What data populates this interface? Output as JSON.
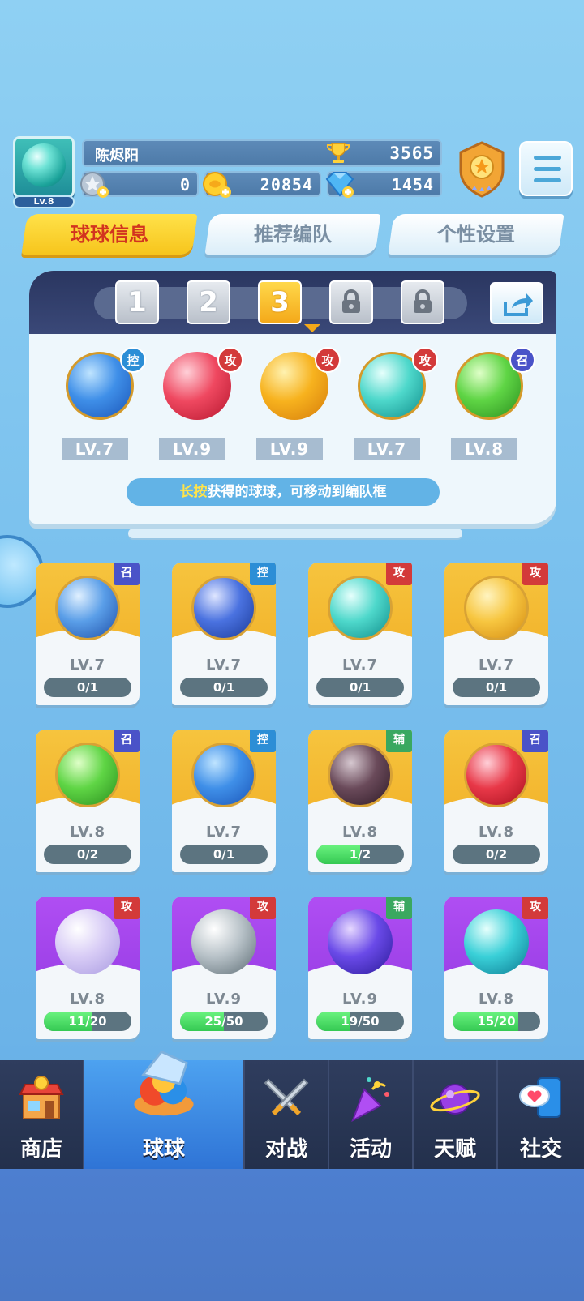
{
  "player": {
    "name": "陈烬阳",
    "level": "Lv.8",
    "trophies": "3565",
    "resource_1": "0",
    "gold": "20854",
    "gems": "1454"
  },
  "tabs": [
    "球球信息",
    "推荐编队",
    "个性设置"
  ],
  "team_slots": [
    "1",
    "2",
    "3",
    "lock",
    "lock"
  ],
  "active_slot": "3",
  "team": [
    {
      "level": "LV.7",
      "badge": "控"
    },
    {
      "level": "LV.9",
      "badge": "攻"
    },
    {
      "level": "LV.9",
      "badge": "攻"
    },
    {
      "level": "LV.7",
      "badge": "攻"
    },
    {
      "level": "LV.8",
      "badge": "召"
    }
  ],
  "hint": {
    "highlight": "长按",
    "rest": "获得的球球，可移动到编队框"
  },
  "cards": [
    {
      "level": "LV.7",
      "badge": "召",
      "progress": "0/1",
      "fraction": 0
    },
    {
      "level": "LV.7",
      "badge": "控",
      "progress": "0/1",
      "fraction": 0
    },
    {
      "level": "LV.7",
      "badge": "攻",
      "progress": "0/1",
      "fraction": 0
    },
    {
      "level": "LV.7",
      "badge": "攻",
      "progress": "0/1",
      "fraction": 0
    },
    {
      "level": "LV.8",
      "badge": "召",
      "progress": "0/2",
      "fraction": 0
    },
    {
      "level": "LV.7",
      "badge": "控",
      "progress": "0/1",
      "fraction": 0
    },
    {
      "level": "LV.8",
      "badge": "辅",
      "progress": "1/2",
      "fraction": 0.5
    },
    {
      "level": "LV.8",
      "badge": "召",
      "progress": "0/2",
      "fraction": 0
    },
    {
      "level": "LV.8",
      "badge": "攻",
      "progress": "11/20",
      "fraction": 0.55
    },
    {
      "level": "LV.9",
      "badge": "攻",
      "progress": "25/50",
      "fraction": 0.5
    },
    {
      "level": "LV.9",
      "badge": "辅",
      "progress": "19/50",
      "fraction": 0.38
    },
    {
      "level": "LV.8",
      "badge": "攻",
      "progress": "15/20",
      "fraction": 0.75
    }
  ],
  "nav": [
    "商店",
    "球球",
    "对战",
    "活动",
    "天赋",
    "社交"
  ],
  "active_nav": "球球",
  "colors": {
    "tab_active": "#f7c51c",
    "nav_active": "#2f74d6",
    "progress": "#35c953"
  }
}
